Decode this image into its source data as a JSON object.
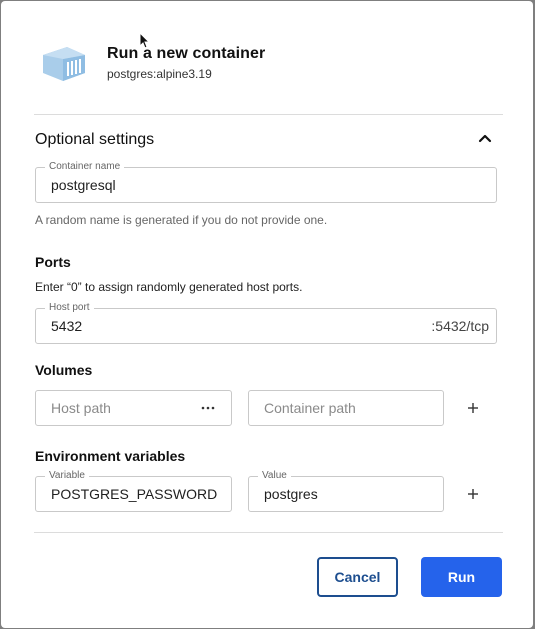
{
  "header": {
    "title": "Run a new container",
    "image": "postgres:alpine3.19",
    "icon": "container-icon"
  },
  "optional": {
    "title": "Optional settings",
    "toggle_icon": "chevron-up-icon"
  },
  "container_name": {
    "label": "Container name",
    "value": "postgresql",
    "helper": "A random name is generated if you do not provide one."
  },
  "ports": {
    "heading": "Ports",
    "description": "Enter “0” to assign randomly generated host ports.",
    "host_port_label": "Host port",
    "host_port_value": "5432",
    "container_port": ":5432/tcp"
  },
  "volumes": {
    "heading": "Volumes",
    "host_path_placeholder": "Host path",
    "browse_label": "···",
    "container_path_placeholder": "Container path",
    "add_icon": "plus-icon"
  },
  "env": {
    "heading": "Environment variables",
    "variable_label": "Variable",
    "variable_value": "POSTGRES_PASSWORD",
    "value_label": "Value",
    "value_value": "postgres",
    "add_icon": "plus-icon"
  },
  "actions": {
    "cancel_label": "Cancel",
    "run_label": "Run"
  },
  "colors": {
    "primary": "#2563eb",
    "cancel_border": "#1d4e8f",
    "icon_blue": "#5b9bd5"
  }
}
